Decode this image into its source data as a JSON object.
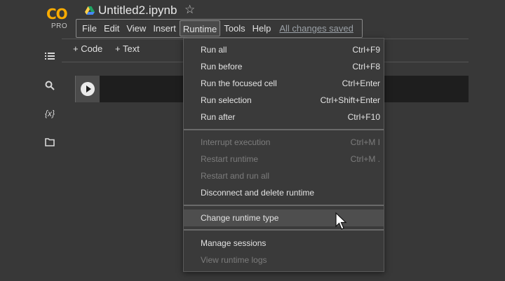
{
  "logo": {
    "mark": "CO",
    "tier": "PRO"
  },
  "notebook": {
    "title": "Untitled2.ipynb"
  },
  "menubar": {
    "items": [
      "File",
      "Edit",
      "View",
      "Insert",
      "Runtime",
      "Tools",
      "Help"
    ],
    "save_status": "All changes saved"
  },
  "toolbar": {
    "add_code": "+ Code",
    "add_text": "+ Text"
  },
  "sidebar": {
    "variables_label": "{x}"
  },
  "runtime_menu": {
    "items": [
      {
        "label": "Run all",
        "shortcut": "Ctrl+F9"
      },
      {
        "label": "Run before",
        "shortcut": "Ctrl+F8"
      },
      {
        "label": "Run the focused cell",
        "shortcut": "Ctrl+Enter"
      },
      {
        "label": "Run selection",
        "shortcut": "Ctrl+Shift+Enter"
      },
      {
        "label": "Run after",
        "shortcut": "Ctrl+F10"
      },
      {
        "label": "Interrupt execution",
        "shortcut": "Ctrl+M I"
      },
      {
        "label": "Restart runtime",
        "shortcut": "Ctrl+M ."
      },
      {
        "label": "Restart and run all",
        "shortcut": ""
      },
      {
        "label": "Disconnect and delete runtime",
        "shortcut": ""
      },
      {
        "label": "Change runtime type",
        "shortcut": ""
      },
      {
        "label": "Manage sessions",
        "shortcut": ""
      },
      {
        "label": "View runtime logs",
        "shortcut": ""
      }
    ]
  },
  "colors": {
    "background": "#383838",
    "brand": "#f9ab00",
    "menu_bg": "#3a3a3a",
    "disabled_text": "#7c7c7c",
    "link": "#9aa0a6"
  }
}
